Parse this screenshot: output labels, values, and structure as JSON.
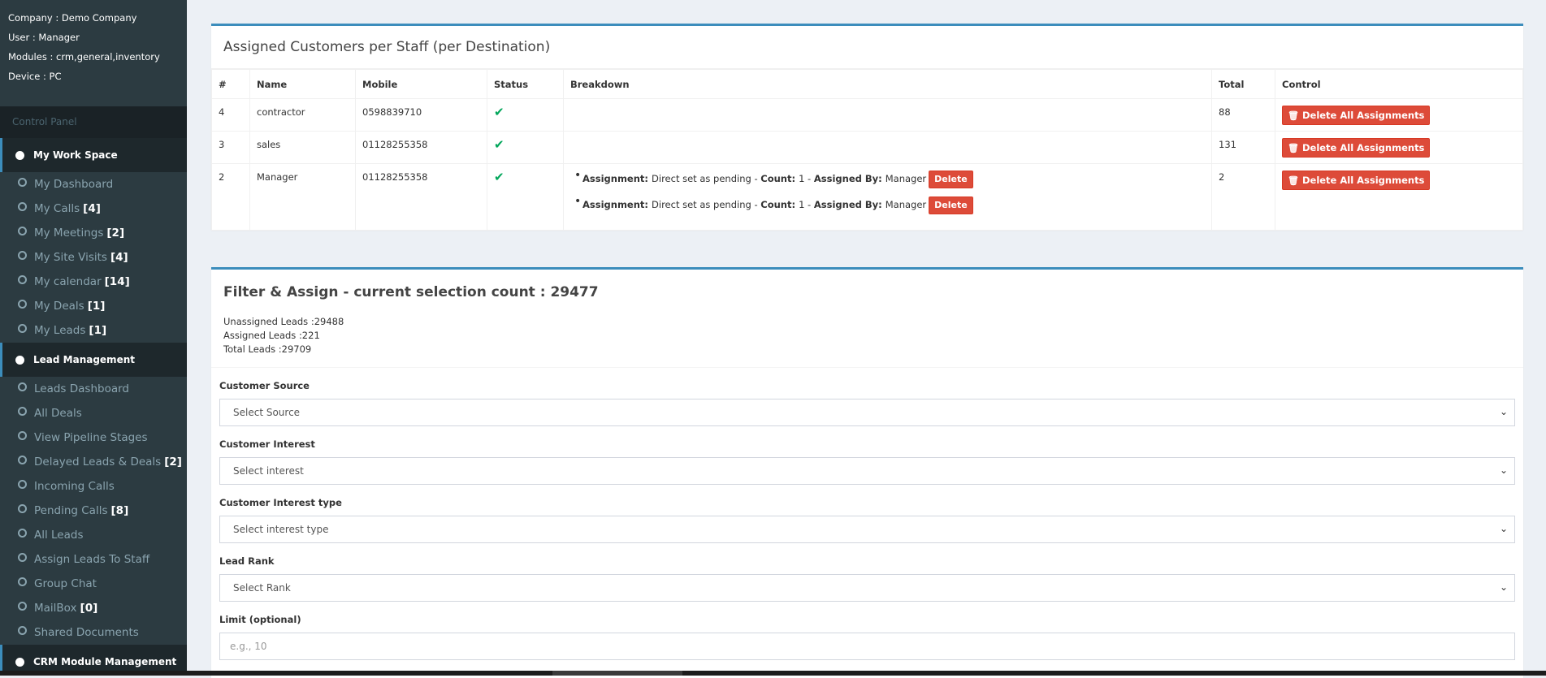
{
  "user_panel": {
    "company": "Company : Demo Company",
    "user": "User : Manager",
    "modules": "Modules : crm,general,inventory",
    "device": "Device : PC"
  },
  "sidebar": {
    "header": "Control Panel",
    "workspace": {
      "label": "My Work Space",
      "items": [
        {
          "label": "My Dashboard",
          "count": ""
        },
        {
          "label": "My Calls",
          "count": "[4]"
        },
        {
          "label": "My Meetings",
          "count": "[2]"
        },
        {
          "label": "My Site Visits",
          "count": "[4]"
        },
        {
          "label": "My calendar",
          "count": "[14]"
        },
        {
          "label": "My Deals",
          "count": "[1]"
        },
        {
          "label": "My Leads",
          "count": "[1]"
        }
      ]
    },
    "lead_mgmt": {
      "label": "Lead Management",
      "items": [
        {
          "label": "Leads Dashboard",
          "count": ""
        },
        {
          "label": "All Deals",
          "count": ""
        },
        {
          "label": "View Pipeline Stages",
          "count": ""
        },
        {
          "label": "Delayed Leads & Deals",
          "count": "[2]"
        },
        {
          "label": "Incoming Calls",
          "count": ""
        },
        {
          "label": "Pending Calls",
          "count": "[8]"
        },
        {
          "label": "All Leads",
          "count": ""
        },
        {
          "label": "Assign Leads To Staff",
          "count": ""
        },
        {
          "label": "Group Chat",
          "count": ""
        },
        {
          "label": "MailBox",
          "count": "[0]"
        },
        {
          "label": "Shared Documents",
          "count": ""
        }
      ]
    },
    "crm_module": {
      "label": "CRM Module Management"
    }
  },
  "assigned": {
    "title": "Assigned Customers per Staff (per Destination)",
    "columns": [
      "#",
      "Name",
      "Mobile",
      "Status",
      "Breakdown",
      "Total",
      "Control"
    ],
    "rows": [
      {
        "num": "4",
        "name": "contractor",
        "mobile": "0598839710",
        "total": "88"
      },
      {
        "num": "3",
        "name": "sales",
        "mobile": "01128255358",
        "total": "131"
      },
      {
        "num": "2",
        "name": "Manager",
        "mobile": "01128255358",
        "total": "2"
      }
    ],
    "breakdown": [
      {
        "assignment_label": "Assignment:",
        "assignment": "Direct set as pending",
        "count_label": "Count:",
        "count": "1",
        "by_label": "Assigned By:",
        "by": "Manager"
      },
      {
        "assignment_label": "Assignment:",
        "assignment": "Direct set as pending",
        "count_label": "Count:",
        "count": "1",
        "by_label": "Assigned By:",
        "by": "Manager"
      }
    ],
    "delete_all_label": "Delete All Assignments",
    "delete_label": "Delete",
    "status_icon": "check-icon"
  },
  "filter": {
    "title": "Filter & Assign - current selection count : 29477",
    "unassigned": "Unassigned Leads :29488",
    "assigned": "Assigned Leads :221",
    "total": "Total Leads :29709",
    "source_label": "Customer Source",
    "source_value": "Select Source",
    "interest_label": "Customer Interest",
    "interest_value": "Select interest",
    "interest_type_label": "Customer Interest type",
    "interest_type_value": "Select interest type",
    "rank_label": "Lead Rank",
    "rank_value": "Select Rank",
    "limit_label": "Limit (optional)",
    "limit_placeholder": "e.g., 10"
  },
  "colors": {
    "accent": "#3c8dbc",
    "danger": "#dd4b39",
    "success": "#00a65a",
    "sidebar": "#222d32"
  }
}
